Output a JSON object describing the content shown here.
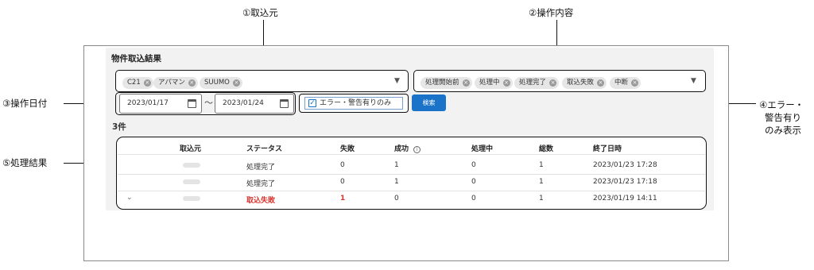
{
  "annotations": {
    "a1": "①取込元",
    "a2": "②操作内容",
    "a3": "③操作日付",
    "a4_line1": "④エラー・",
    "a4_line2": "警告有り",
    "a4_line3": "のみ表示",
    "a5": "⑤処理結果"
  },
  "page": {
    "title": "物件取込結果"
  },
  "source_filter": {
    "chips": [
      "C21",
      "アパマン",
      "SUUMO"
    ]
  },
  "operation_filter": {
    "chips": [
      "処理開始前",
      "処理中",
      "処理完了",
      "取込失敗",
      "中断"
    ]
  },
  "date_filter": {
    "from": "2023/01/17",
    "separator": "〜",
    "to": "2023/01/24"
  },
  "error_only": {
    "label": "エラー・警告有りのみ",
    "checked": true
  },
  "search_button": {
    "label": "検索"
  },
  "result_count": "3件",
  "table": {
    "headers": [
      "取込元",
      "ステータス",
      "失敗",
      "成功",
      "処理中",
      "総数",
      "終了日時"
    ],
    "rows": [
      {
        "status": "処理完了",
        "fail": "0",
        "success": "1",
        "processing": "0",
        "total": "1",
        "end": "2023/01/23 17:28",
        "error": false
      },
      {
        "status": "処理完了",
        "fail": "0",
        "success": "1",
        "processing": "0",
        "total": "1",
        "end": "2023/01/23 17:18",
        "error": false
      },
      {
        "status": "取込失敗",
        "fail": "1",
        "success": "0",
        "processing": "0",
        "total": "1",
        "end": "2023/01/19 14:11",
        "error": true
      }
    ]
  },
  "colors": {
    "primary": "#1a73c8",
    "error": "#d9322b",
    "panel": "#f2f2f2"
  },
  "icons": {
    "calendar": "calendar-icon",
    "clear": "clear-chip-icon",
    "dropdown": "chevron-down-icon",
    "info": "info-icon",
    "expand": "expand-row-icon"
  }
}
